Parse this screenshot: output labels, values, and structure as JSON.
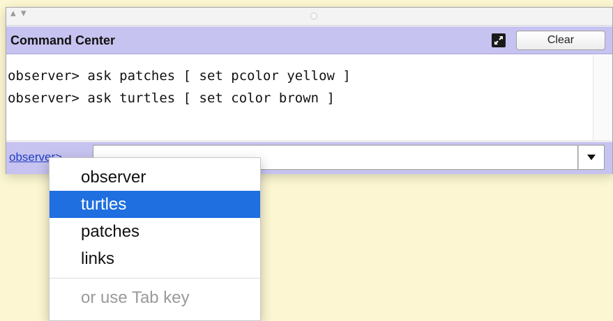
{
  "command_center": {
    "title": "Command Center",
    "clear_label": "Clear",
    "output_lines": [
      "observer> ask patches [ set pcolor yellow ]",
      "observer> ask turtles [ set color brown ]"
    ],
    "agent_prompt": "observer>",
    "input_value": ""
  },
  "agent_menu": {
    "items": [
      "observer",
      "turtles",
      "patches",
      "links"
    ],
    "selected": "turtles",
    "hint": "or use Tab key"
  },
  "icons": {
    "expand": "expand-icon",
    "dropdown": "triangle-down-icon",
    "splitter": "split-arrows-icon"
  },
  "colors": {
    "title_bar": "#c7c3f0",
    "selection": "#1f6fe0",
    "background": "#fcf7d2",
    "link": "#2040c0"
  }
}
